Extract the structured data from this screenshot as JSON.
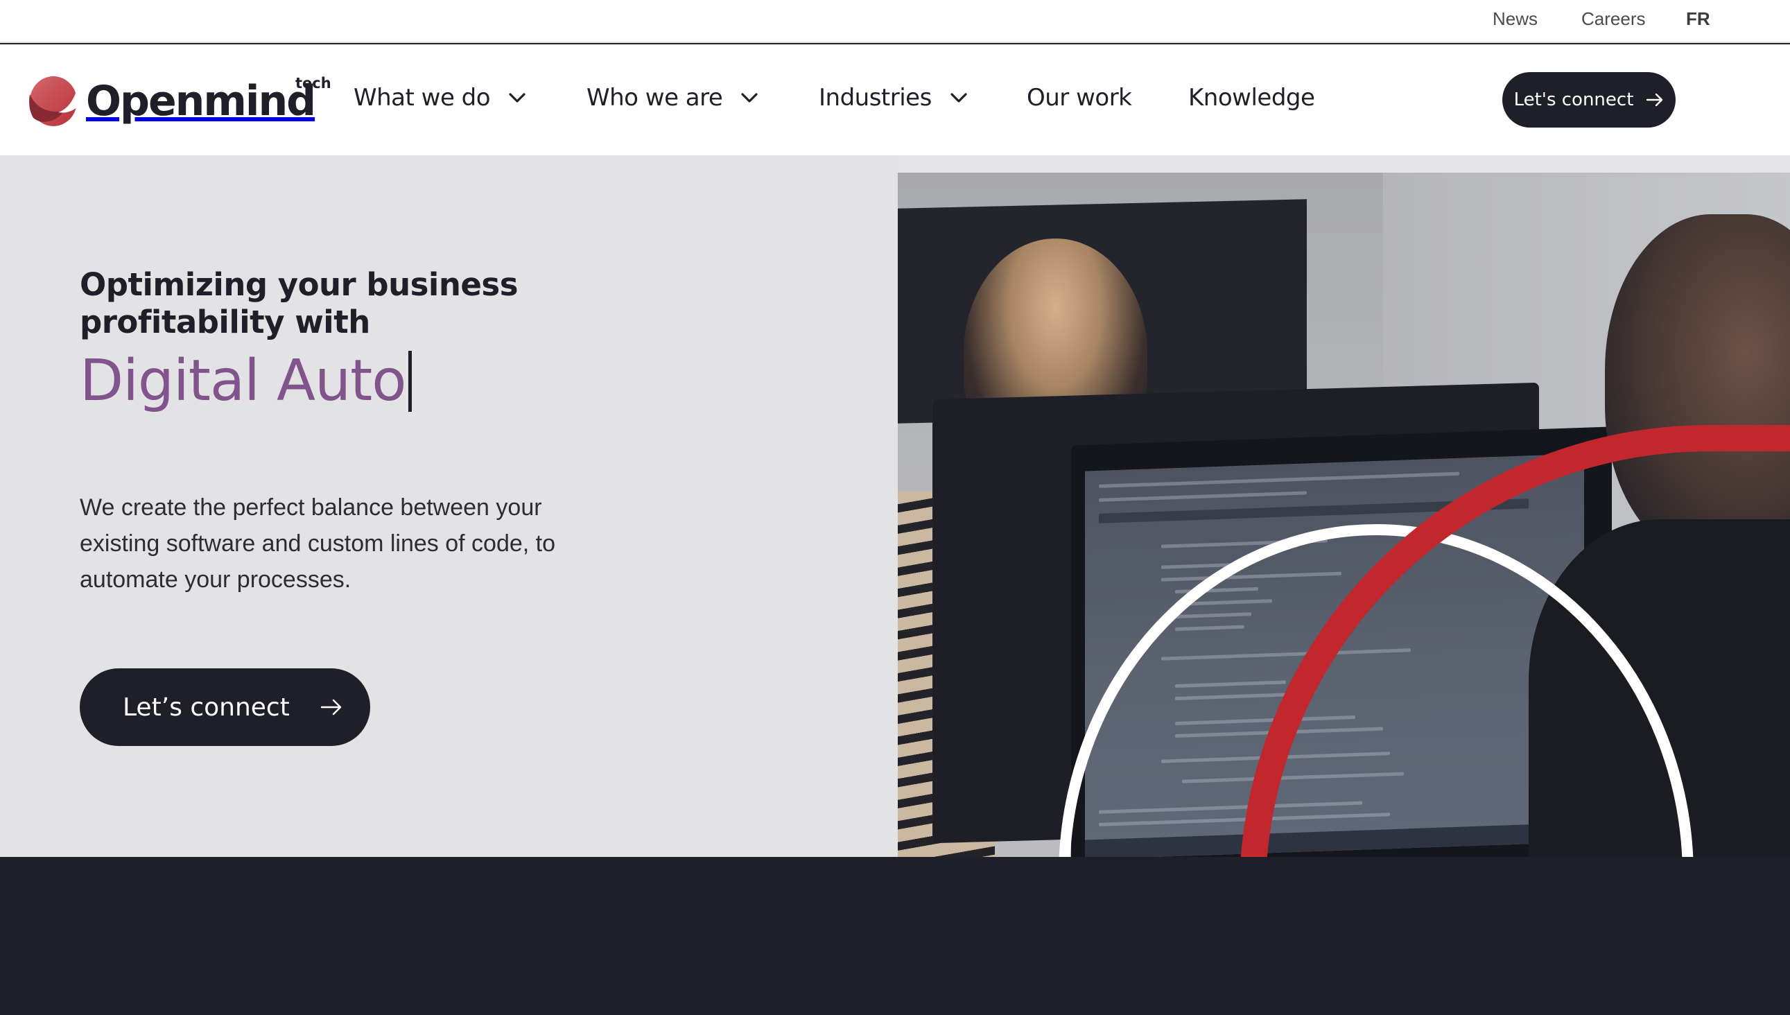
{
  "topbar": {
    "links": [
      {
        "label": "News"
      },
      {
        "label": "Careers"
      },
      {
        "label": "FR"
      }
    ]
  },
  "nav": {
    "logo": {
      "name": "Openmind",
      "suffix": "tech",
      "icon": "openmind-logo-icon"
    },
    "menu": [
      {
        "label": "What we do",
        "has_dropdown": true
      },
      {
        "label": "Who we are",
        "has_dropdown": true
      },
      {
        "label": "Industries",
        "has_dropdown": true
      },
      {
        "label": "Our work",
        "has_dropdown": false
      },
      {
        "label": "Knowledge",
        "has_dropdown": false
      }
    ],
    "cta": {
      "label": "Let's connect",
      "icon": "arrow-right-icon"
    }
  },
  "hero": {
    "kicker": "Optimizing your business profitability with",
    "typed_text": "Digital Auto",
    "lead": "We create the perfect balance between your existing software and custom lines of code, to automate your processes.",
    "cta": {
      "label": "Let’s connect",
      "icon": "arrow-right-icon"
    },
    "image_alt": "Developers working at computer monitors with code on screen"
  },
  "colors": {
    "brand_dark": "#1e1f28",
    "accent_purple": "#82548c",
    "accent_red": "#c1272d",
    "hero_bg": "#e3e3e5"
  }
}
